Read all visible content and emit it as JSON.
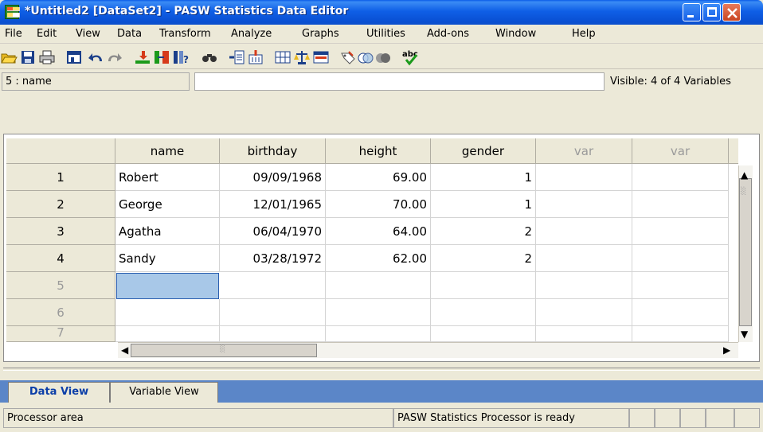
{
  "window": {
    "title": "*Untitled2 [DataSet2] - PASW Statistics Data Editor"
  },
  "menu": {
    "items": [
      "File",
      "Edit",
      "View",
      "Data",
      "Transform",
      "Analyze",
      "Graphs",
      "Utilities",
      "Add-ons",
      "Window",
      "Help"
    ]
  },
  "toolbar": {
    "icons": [
      "open-icon",
      "save-icon",
      "print-icon",
      "dialog-recall-icon",
      "undo-icon",
      "redo-icon",
      "goto-case-icon",
      "goto-variable-icon",
      "variables-icon",
      "find-icon",
      "insert-cases-icon",
      "insert-variable-icon",
      "split-file-icon",
      "weight-cases-icon",
      "select-cases-icon",
      "value-labels-icon",
      "use-sets-icon",
      "show-all-variables-icon",
      "spelling-icon"
    ]
  },
  "cell_editor": {
    "reference": "5 : name",
    "value": "",
    "visible_variables": "Visible: 4 of 4 Variables"
  },
  "grid": {
    "columns": [
      "name",
      "birthday",
      "height",
      "gender",
      "var",
      "var"
    ],
    "rows": [
      {
        "num": "1",
        "name": "Robert",
        "birthday": "09/09/1968",
        "height": "69.00",
        "gender": "1"
      },
      {
        "num": "2",
        "name": "George",
        "birthday": "12/01/1965",
        "height": "70.00",
        "gender": "1"
      },
      {
        "num": "3",
        "name": "Agatha",
        "birthday": "06/04/1970",
        "height": "64.00",
        "gender": "2"
      },
      {
        "num": "4",
        "name": "Sandy",
        "birthday": "03/28/1972",
        "height": "62.00",
        "gender": "2"
      },
      {
        "num": "5",
        "name": "",
        "birthday": "",
        "height": "",
        "gender": ""
      },
      {
        "num": "6",
        "name": "",
        "birthday": "",
        "height": "",
        "gender": ""
      }
    ],
    "partial_row_label": "7"
  },
  "tabs": {
    "data_view": "Data View",
    "variable_view": "Variable View"
  },
  "status": {
    "left": "Processor area",
    "processor": "PASW Statistics  Processor is ready"
  },
  "colors": {
    "titlebar": "#0a52d6",
    "selected_cell": "#a8c8e8",
    "tabstrip": "#5b86c8"
  }
}
